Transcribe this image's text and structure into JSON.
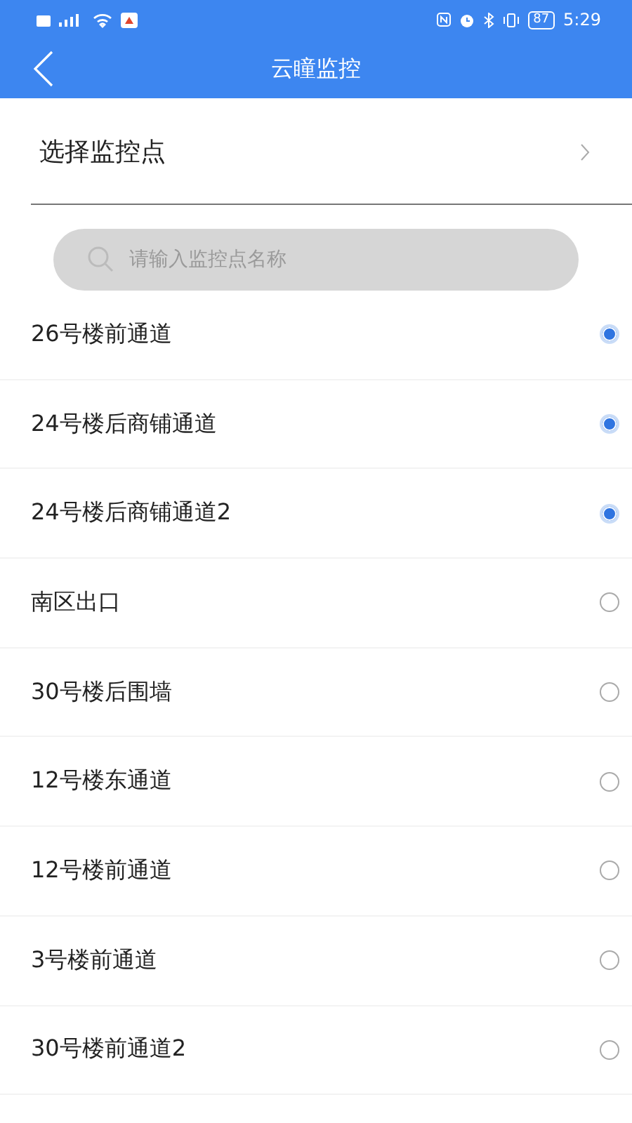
{
  "status_bar": {
    "battery": "87",
    "time": "5:29"
  },
  "nav_bar": {
    "title": "云瞳监控"
  },
  "picker": {
    "label": "选择监控点"
  },
  "search": {
    "placeholder": "请输入监控点名称"
  },
  "points": [
    {
      "name": "26号楼前通道",
      "checked": true
    },
    {
      "name": "24号楼后商铺通道",
      "checked": true
    },
    {
      "name": "24号楼后商铺通道2",
      "checked": true
    },
    {
      "name": "南区出口",
      "checked": false
    },
    {
      "name": "30号楼后围墙",
      "checked": false
    },
    {
      "name": "12号楼东通道",
      "checked": false
    },
    {
      "name": "12号楼前通道",
      "checked": false
    },
    {
      "name": "3号楼前通道",
      "checked": false
    },
    {
      "name": "30号楼前通道2",
      "checked": false
    }
  ]
}
